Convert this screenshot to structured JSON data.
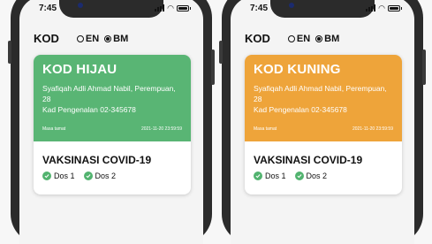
{
  "colors": {
    "green": "#59b574",
    "orange": "#eea43a",
    "check": "#52b36f"
  },
  "phones": [
    {
      "status_bar": {
        "time": "7:45"
      },
      "header": {
        "app_title": "KOD",
        "lang_en": "EN",
        "lang_bm": "BM",
        "selected_lang": "BM"
      },
      "card": {
        "status_title": "KOD HIJAU",
        "name_line": "Syafiqah Adli Ahmad Nabil, Perempuan, 28",
        "id_line": "Kad Pengenalan 02-345678",
        "validity_label": "Masa tamat",
        "validity_time": "2021-11-20 23:59:59",
        "vaccination_title": "VAKSINASI COVID-19",
        "dose1": "Dos 1",
        "dose2": "Dos 2"
      }
    },
    {
      "status_bar": {
        "time": "7:45"
      },
      "header": {
        "app_title": "KOD",
        "lang_en": "EN",
        "lang_bm": "BM",
        "selected_lang": "BM"
      },
      "card": {
        "status_title": "KOD KUNING",
        "name_line": "Syafiqah Adli Ahmad Nabil, Perempuan, 28",
        "id_line": "Kad Pengenalan 02-345678",
        "validity_label": "Masa tamat",
        "validity_time": "2021-11-20 23:59:59",
        "vaccination_title": "VAKSINASI COVID-19",
        "dose1": "Dos 1",
        "dose2": "Dos 2"
      }
    }
  ]
}
